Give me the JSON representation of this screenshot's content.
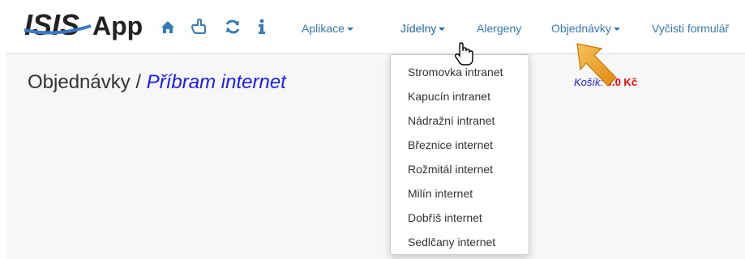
{
  "brand": {
    "logo_mark": "ISIS",
    "logo_text": "App"
  },
  "nav": {
    "icons": [
      "home-icon",
      "pointer-hand-icon",
      "refresh-icon",
      "info-icon"
    ],
    "aplikace_label": "Aplikace",
    "jidelny_label": "Jídelny",
    "alergeny_label": "Alergeny",
    "objednavky_label": "Objednávky",
    "clear_form_label": "Vyčisti formulář"
  },
  "dropdown": {
    "items": [
      "Stromovka intranet",
      "Kapucín intranet",
      "Nádražní intranet",
      "Březnice internet",
      "Rožmitál internet",
      "Milín internet",
      "Dobříš internet",
      "Sedlčany internet"
    ]
  },
  "page": {
    "breadcrumb_root": "Objednávky",
    "separator": " / ",
    "current_place": "Příbram internet"
  },
  "cart": {
    "label": "Košík:",
    "amount": "0.0 Kč"
  },
  "colors": {
    "link": "#337ab7",
    "place": "#1a1aff",
    "price": "#ff0000",
    "logo_dark": "#222222",
    "logo_blue": "#3a78c2",
    "arrow": "#f0a020"
  }
}
